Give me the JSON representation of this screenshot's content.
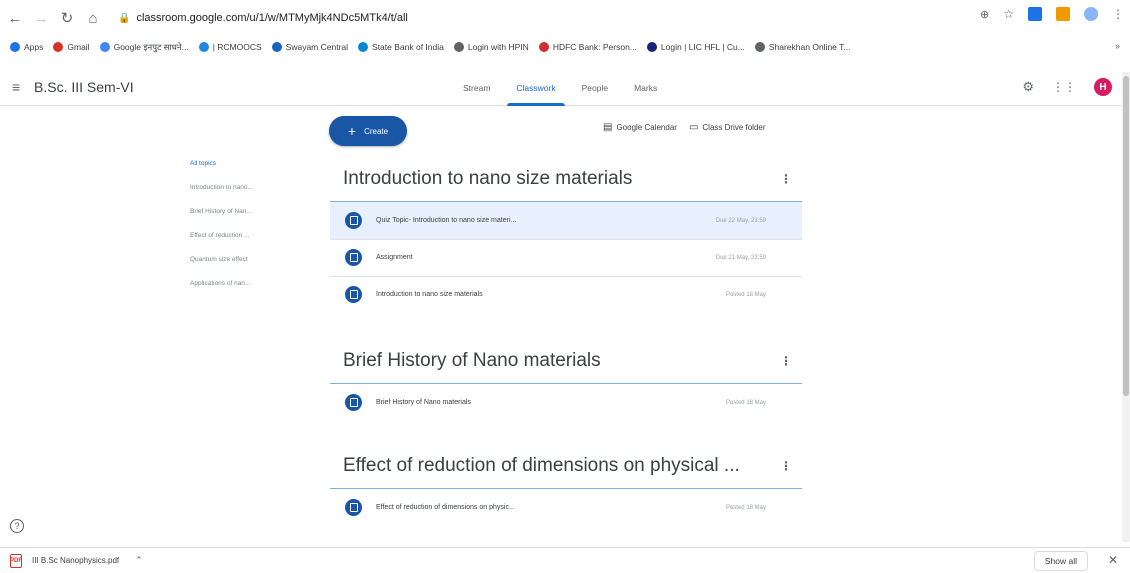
{
  "browser": {
    "url": "classroom.google.com/u/1/w/MTMyMjk4NDc5MTk4/t/all",
    "bookmarks": [
      {
        "label": "Apps",
        "icon": "apps-grid-icon",
        "color": "#1a73e8"
      },
      {
        "label": "Gmail",
        "icon": "gmail-icon",
        "color": "#d93025"
      },
      {
        "label": "Google इनपुट साधने...",
        "icon": "google-icon",
        "color": "#4285f4"
      },
      {
        "label": "| RCMOOCS",
        "icon": "rcmoocs-icon",
        "color": "#1e88e5"
      },
      {
        "label": "Swayam Central",
        "icon": "swayam-icon",
        "color": "#1565c0"
      },
      {
        "label": "State Bank of India",
        "icon": "sbi-icon",
        "color": "#0288d1"
      },
      {
        "label": "Login with HPIN",
        "icon": "globe-icon",
        "color": "#5f6368"
      },
      {
        "label": "HDFC Bank: Person...",
        "icon": "hdfc-icon",
        "color": "#d32f2f"
      },
      {
        "label": "Login | LIC HFL | Cu...",
        "icon": "lic-icon",
        "color": "#1a237e"
      },
      {
        "label": "Sharekhan Online T...",
        "icon": "globe-icon",
        "color": "#5f6368"
      }
    ],
    "bookmarks_more": "»"
  },
  "header": {
    "class_title": "B.Sc. III Sem-VI",
    "tabs": [
      {
        "label": "Stream",
        "active": false
      },
      {
        "label": "Classwork",
        "active": true
      },
      {
        "label": "People",
        "active": false
      },
      {
        "label": "Marks",
        "active": false
      }
    ],
    "avatar_letter": "H",
    "accent": "#1967d2"
  },
  "toolbar": {
    "create_label": "Create",
    "calendar_label": "Google Calendar",
    "drive_label": "Class Drive folder"
  },
  "topics": [
    {
      "label": "All topics",
      "active": true
    },
    {
      "label": "Introduction to nano...",
      "active": false
    },
    {
      "label": "Brief History of Nan...",
      "active": false
    },
    {
      "label": "Effect of reduction ...",
      "active": false
    },
    {
      "label": "Quantum size effect",
      "active": false
    },
    {
      "label": "Applications of nan...",
      "active": false
    }
  ],
  "sections": [
    {
      "title": "Introduction to nano size materials",
      "items": [
        {
          "title": "Quiz Topic- Introduction to nano size materi...",
          "date": "Due 22 May, 23:59",
          "highlighted": true
        },
        {
          "title": "Assignment",
          "date": "Due 21 May, 23:59",
          "highlighted": false
        },
        {
          "title": "Introduction to nano size materials",
          "date": "Posted 18 May",
          "highlighted": false
        }
      ]
    },
    {
      "title": "Brief History of Nano materials",
      "items": [
        {
          "title": "Brief History of Nano materials",
          "date": "Posted 18 May",
          "highlighted": false
        }
      ]
    },
    {
      "title": "Effect of reduction of dimensions on physical ...",
      "items": [
        {
          "title": "Effect of reduction of dimensions on physic...",
          "date": "Posted 18 May",
          "highlighted": false
        }
      ]
    }
  ],
  "downloads": {
    "file_name": "III B.Sc Nanophysics.pdf",
    "show_all_label": "Show all"
  }
}
